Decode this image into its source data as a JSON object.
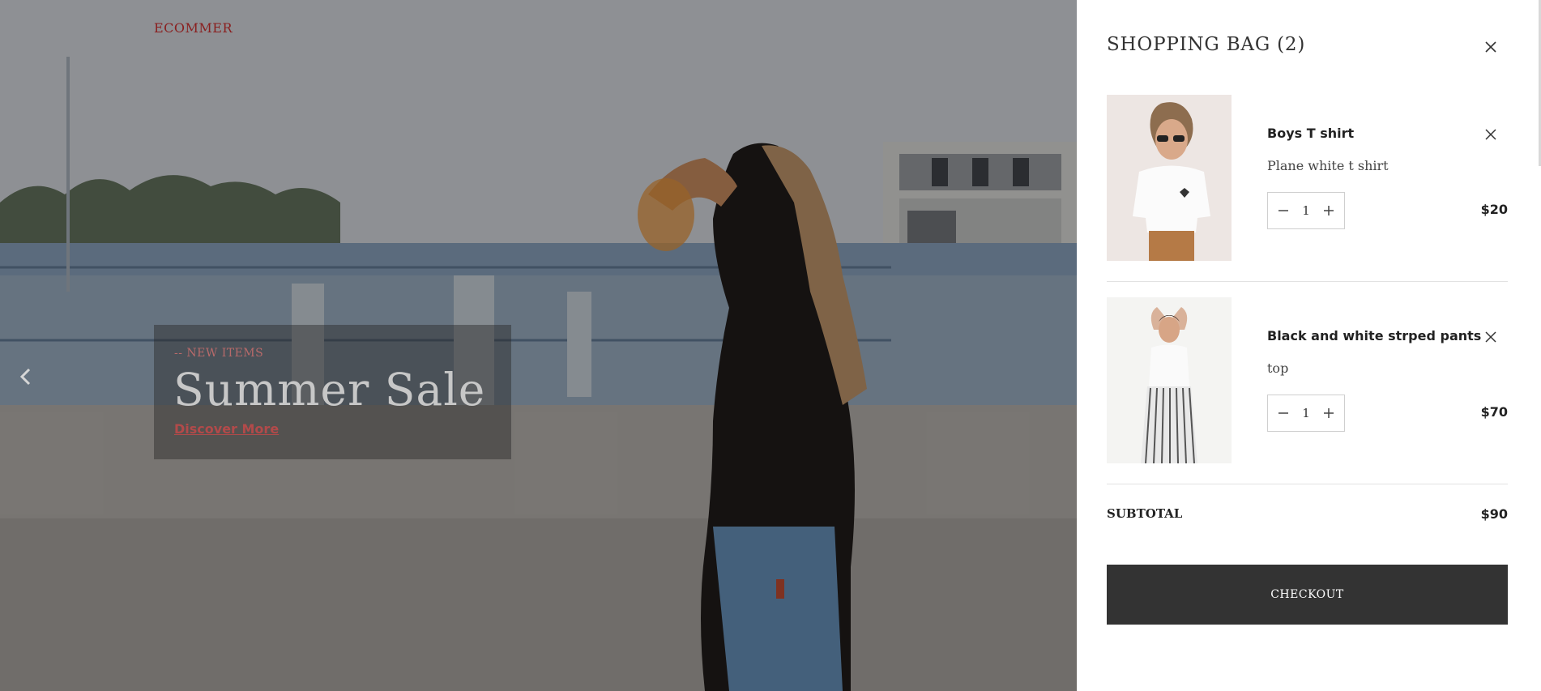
{
  "header": {
    "brand": "ECOMMER"
  },
  "hero": {
    "eyebrow": "-- NEW ITEMS",
    "title": "Summer Sale",
    "cta_label": "Discover More"
  },
  "cart": {
    "title": "SHOPPING BAG (2)",
    "items": [
      {
        "name": "Boys T shirt",
        "variant": "Plane white t shirt",
        "quantity": "1",
        "price": "$20"
      },
      {
        "name": "Black and white strped pants",
        "variant": "top",
        "quantity": "1",
        "price": "$70"
      }
    ],
    "subtotal_label": "SUBTOTAL",
    "subtotal_value": "$90",
    "checkout_label": "CHECKOUT"
  },
  "icons": {
    "close": "close-icon",
    "minus": "minus-icon",
    "plus": "plus-icon",
    "prev": "chevron-left-icon"
  },
  "colors": {
    "brand": "#8a1f1f",
    "checkout_bg": "#333333",
    "drawer_bg": "#ffffff"
  }
}
